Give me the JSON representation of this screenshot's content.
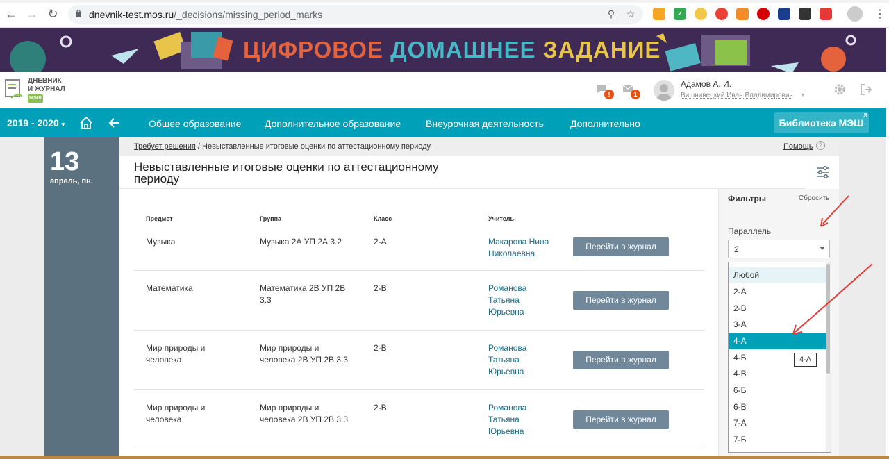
{
  "browser": {
    "url_domain": "dnevnik-test.mos.ru",
    "url_path": "/_decisions/missing_period_marks"
  },
  "banner": {
    "word1": "ЦИФРОВОЕ",
    "word2": "ДОМАШНЕЕ",
    "word3": "ЗАДАНИЕ"
  },
  "header": {
    "logo_line1": "ДНЕВНИК",
    "logo_line2": "И ЖУРНАЛ",
    "logo_mesh": "МЭШ",
    "notif_badge": "!",
    "mail_badge": "1",
    "user_name": "Адамов А. И.",
    "user_sub": "Вишнивецкий Иван Владимирович"
  },
  "nav": {
    "year": "2019 - 2020",
    "items": [
      "Общее образование",
      "Дополнительное образование",
      "Внеурочная деятельность",
      "Дополнительно"
    ],
    "library": "Библиотека МЭШ"
  },
  "date": {
    "day": "13",
    "sub": "апрель, пн."
  },
  "breadcrumb": {
    "link": "Требует решения",
    "separator": " / ",
    "current": "Невыставленные итоговые оценки по аттестационному периоду"
  },
  "help": {
    "label": "Помощь",
    "icon": "?"
  },
  "page": {
    "title_line1": "Невыставленные итоговые оценки по аттестационному",
    "title_line2": "периоду"
  },
  "table": {
    "headers": [
      "Предмет",
      "Группа",
      "Класс",
      "Учитель"
    ],
    "rows": [
      {
        "subject": [
          "Музыка"
        ],
        "group": [
          "Музыка 2А УП 2А 3.2"
        ],
        "class": "2-А",
        "teacher": [
          "Макарова Нина",
          "Николаевна"
        ],
        "button": "Перейти в журнал"
      },
      {
        "subject": [
          "Математика"
        ],
        "group": [
          "Математика 2В УП 2В",
          "3.3"
        ],
        "class": "2-В",
        "teacher": [
          "Романова",
          "Татьяна",
          "Юрьевна"
        ],
        "button": "Перейти в журнал"
      },
      {
        "subject": [
          "Мир природы и",
          "человека"
        ],
        "group": [
          "Мир природы и",
          "человека 2В УП 2В 3.3"
        ],
        "class": "2-В",
        "teacher": [
          "Романова",
          "Татьяна",
          "Юрьевна"
        ],
        "button": "Перейти в журнал"
      },
      {
        "subject": [
          "Мир природы и",
          "человека"
        ],
        "group": [
          "Мир природы и",
          "человека 2В УП 2В 3.3"
        ],
        "class": "2-В",
        "teacher": [
          "Романова",
          "Татьяна",
          "Юрьевна"
        ],
        "button": "Перейти в журнал"
      }
    ]
  },
  "filters": {
    "title": "Фильтры",
    "reset": "Сбросить",
    "parallel_label": "Параллель",
    "parallel_value": "2",
    "options": [
      "Любой",
      "2-А",
      "2-В",
      "3-А",
      "4-А",
      "4-Б",
      "4-В",
      "6-Б",
      "6-В",
      "7-А",
      "7-Б"
    ],
    "hovered": "Любой",
    "highlighted": "4-А",
    "tooltip": "4-А"
  },
  "colors": {
    "nav_bg": "#00a0b8",
    "banner_bg": "#3f2a56",
    "date_panel": "#5b7180",
    "button": "#70889a",
    "highlight": "#00a0b8",
    "annotation_arrow": "#e53935"
  }
}
